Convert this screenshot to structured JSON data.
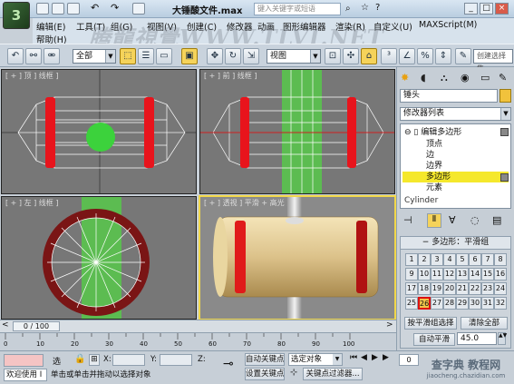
{
  "window": {
    "title": "大锤酸文件.max",
    "search_placeholder": "键入关键字或短语",
    "logo_glyph": "3",
    "watermark": "腾龍視覺WWW.TLVI.NET"
  },
  "menu": {
    "row1": [
      "编辑(E)",
      "工具(T)",
      "组(G)",
      "视图(V)",
      "创建(C)",
      "修改器",
      "动画",
      "图形编辑器",
      "渲染(R)",
      "自定义(U)",
      "MAXScript(M)"
    ],
    "row2": [
      "帮助(H)"
    ]
  },
  "toolbar": {
    "selection_filter": "全部",
    "reference_coord": "视图",
    "named_selection": "创建选择集"
  },
  "viewports": {
    "top_label": "[ + ] 顶 ] 线框 ]",
    "front_label": "[ + ] 前 ] 线框 ]",
    "left_label": "[ + ] 左 ] 线框 ]",
    "persp_label": "[ + ] 透视 ] 平滑 + 高光 ]"
  },
  "command_panel": {
    "object_name": "锤头",
    "modifier_list": "修改器列表",
    "stack": [
      {
        "label": "编辑多边形",
        "level": 0
      },
      {
        "label": "顶点",
        "level": 1
      },
      {
        "label": "边",
        "level": 1
      },
      {
        "label": "边界",
        "level": 1
      },
      {
        "label": "多边形",
        "level": 1,
        "selected": true
      },
      {
        "label": "元素",
        "level": 1
      },
      {
        "label": "Cylinder",
        "level": 0
      }
    ],
    "rollout_title": "多边形：平滑组",
    "smoothing_groups": [
      "1",
      "2",
      "3",
      "4",
      "5",
      "6",
      "7",
      "8",
      "9",
      "10",
      "11",
      "12",
      "13",
      "14",
      "15",
      "16",
      "17",
      "18",
      "19",
      "20",
      "21",
      "22",
      "23",
      "24",
      "25",
      "26",
      "27",
      "28",
      "29",
      "30",
      "31",
      "32"
    ],
    "highlighted_group": "26",
    "select_by_sg": "按平滑组选择",
    "clear_all": "清除全部",
    "auto_smooth": "自动平滑",
    "auto_smooth_value": "45.0"
  },
  "timeline": {
    "frame_label": "0 / 100",
    "ruler_ticks": [
      "0",
      "10",
      "20",
      "30",
      "40",
      "50",
      "60",
      "70",
      "80",
      "90",
      "100"
    ]
  },
  "status_bar": {
    "welcome": "欢迎使用 I",
    "prompt": "单击或单击并拖动以选择对象",
    "selection_label": "选",
    "x_label": "X:",
    "y_label": "Y:",
    "z_label": "Z:",
    "auto_key": "自动关键点",
    "selected_object": "选定对象",
    "set_key": "设置关键点",
    "key_filters": "关键点过滤器...",
    "frame_value": "0",
    "site_watermark": "查字典 教程网",
    "site_url": "jiaocheng.chazidian.com"
  }
}
